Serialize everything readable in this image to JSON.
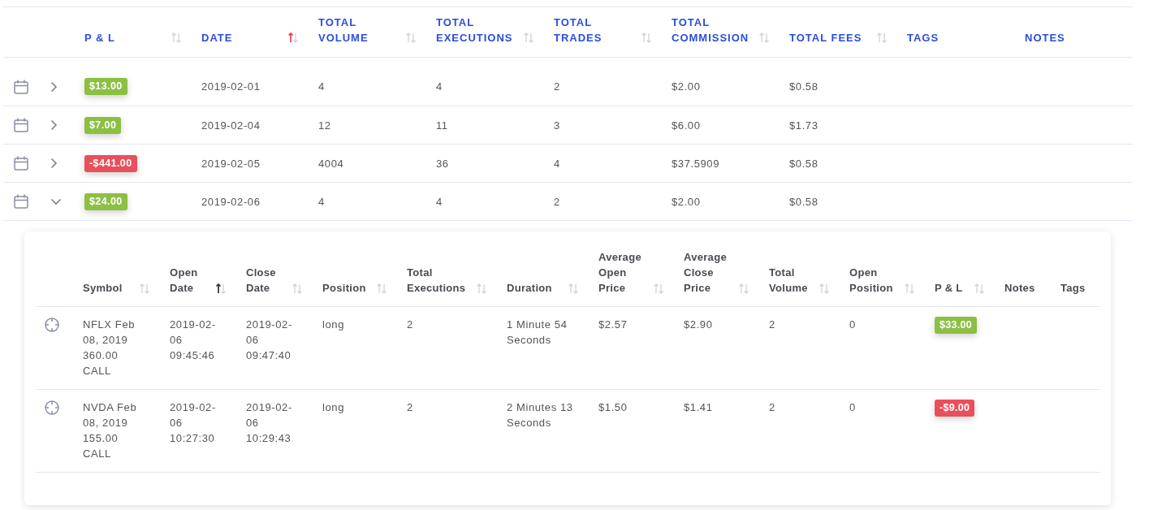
{
  "days_table": {
    "columns": [
      {
        "label": "P & L",
        "sorted": false
      },
      {
        "label": "DATE",
        "sorted": true
      },
      {
        "label": "TOTAL VOLUME",
        "sorted": false
      },
      {
        "label": "TOTAL EXECUTIONS",
        "sorted": false
      },
      {
        "label": "TOTAL TRADES",
        "sorted": false
      },
      {
        "label": "TOTAL COMMISSION",
        "sorted": false
      },
      {
        "label": "TOTAL FEES",
        "sorted": false
      },
      {
        "label": "TAGS"
      },
      {
        "label": "NOTES"
      }
    ],
    "rows": [
      {
        "expanded": false,
        "cells": [
          {
            "text": "$13.00",
            "color": "#8bc043"
          },
          "2019-02-01",
          "4",
          "4",
          "2",
          "$2.00",
          "$0.58"
        ]
      },
      {
        "expanded": false,
        "cells": [
          {
            "text": "$7.00",
            "color": "#8bc043"
          },
          "2019-02-04",
          "12",
          "11",
          "3",
          "$6.00",
          "$1.73"
        ]
      },
      {
        "expanded": false,
        "cells": [
          {
            "text": "-$441.00",
            "color": "#e8505b"
          },
          "2019-02-05",
          "4004",
          "36",
          "4",
          "$37.5909",
          "$0.58"
        ]
      },
      {
        "expanded": true,
        "cells": [
          {
            "text": "$24.00",
            "color": "#8bc043"
          },
          "2019-02-06",
          "4",
          "4",
          "2",
          "$2.00",
          "$0.58"
        ],
        "detail": {
          "columns": [
            {
              "label": "Symbol",
              "sorted": false
            },
            {
              "label": "Open Date",
              "sorted": true
            },
            {
              "label": "Close Date",
              "sorted": false
            },
            {
              "label": "Position",
              "sorted": false
            },
            {
              "label": "Total Executions",
              "sorted": false
            },
            {
              "label": "Duration",
              "sorted": false
            },
            {
              "label": "Average Open Price",
              "sorted": false
            },
            {
              "label": "Average Close Price",
              "sorted": false
            },
            {
              "label": "Total Volume",
              "sorted": false
            },
            {
              "label": "Open Position",
              "sorted": false
            },
            {
              "label": "P & L",
              "sorted": false
            },
            {
              "label": "Notes"
            },
            {
              "label": "Tags"
            }
          ],
          "rows": [
            {
              "cells": [
                "NFLX Feb 08, 2019 360.00 CALL",
                "2019-02-06 09:45:46",
                "2019-02-06 09:47:40",
                "long",
                "2",
                "1 Minute 54 Seconds",
                "$2.57",
                "$2.90",
                "2",
                "0",
                {
                  "text": "$33.00",
                  "color": "#8bc043"
                }
              ]
            },
            {
              "cells": [
                "NVDA Feb 08, 2019 155.00 CALL",
                "2019-02-06 10:27:30",
                "2019-02-06 10:29:43",
                "long",
                "2",
                "2 Minutes 13 Seconds",
                "$1.50",
                "$1.41",
                "2",
                "0",
                {
                  "text": "-$9.00",
                  "color": "#e8505b"
                }
              ]
            }
          ]
        }
      }
    ]
  }
}
